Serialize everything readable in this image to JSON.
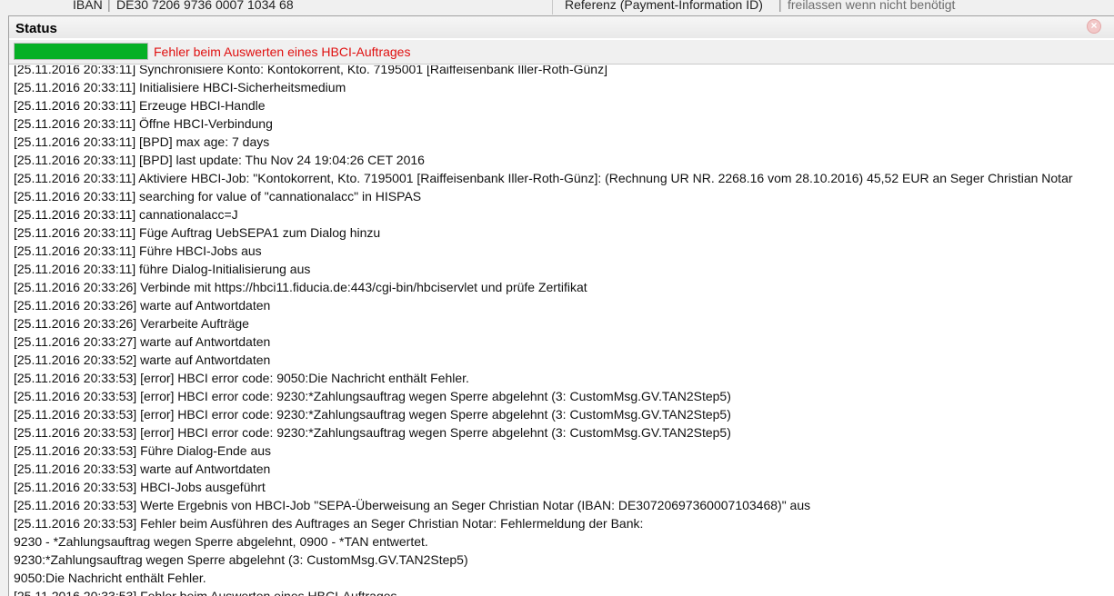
{
  "form_row": {
    "iban_label": "IBAN",
    "iban_value": "DE30 7206 9736 0007 1034 68",
    "reference_label": "Referenz (Payment-Information ID)",
    "reference_hint": "freilassen wenn nicht benötigt"
  },
  "status_panel": {
    "title": "Status",
    "close_icon": "close-icon",
    "progress": {
      "value": 1.0,
      "message": "Fehler beim Auswerten eines HBCI-Auftrages",
      "bar_color": "#06b025",
      "message_color": "#e01010"
    },
    "log": [
      "[25.11.2016 20:33:11] Synchronisiere Konto: Kontokorrent, Kto. 7195001 [Raiffeisenbank Iller-Roth-Günz]",
      "[25.11.2016 20:33:11] Initialisiere HBCI-Sicherheitsmedium",
      "[25.11.2016 20:33:11] Erzeuge HBCI-Handle",
      "[25.11.2016 20:33:11] Öffne HBCI-Verbindung",
      "[25.11.2016 20:33:11] [BPD] max age: 7 days",
      "[25.11.2016 20:33:11] [BPD] last update: Thu Nov 24 19:04:26 CET 2016",
      "[25.11.2016 20:33:11] Aktiviere HBCI-Job: \"Kontokorrent, Kto. 7195001 [Raiffeisenbank Iller-Roth-Günz]: (Rechnung UR NR. 2268.16 vom 28.10.2016) 45,52 EUR an Seger Christian Notar",
      "[25.11.2016 20:33:11] searching for value of \"cannationalacc\" in HISPAS",
      "[25.11.2016 20:33:11] cannationalacc=J",
      "[25.11.2016 20:33:11] Füge Auftrag UebSEPA1 zum Dialog hinzu",
      "[25.11.2016 20:33:11] Führe HBCI-Jobs aus",
      "[25.11.2016 20:33:11] führe Dialog-Initialisierung aus",
      "[25.11.2016 20:33:26] Verbinde mit https://hbci11.fiducia.de:443/cgi-bin/hbciservlet und prüfe Zertifikat",
      "[25.11.2016 20:33:26] warte auf Antwortdaten",
      "[25.11.2016 20:33:26] Verarbeite Aufträge",
      "[25.11.2016 20:33:27] warte auf Antwortdaten",
      "[25.11.2016 20:33:52] warte auf Antwortdaten",
      "[25.11.2016 20:33:53] [error] HBCI error code: 9050:Die Nachricht enthält Fehler.",
      "[25.11.2016 20:33:53] [error] HBCI error code: 9230:*Zahlungsauftrag wegen Sperre abgelehnt (3: CustomMsg.GV.TAN2Step5)",
      "[25.11.2016 20:33:53] [error] HBCI error code: 9230:*Zahlungsauftrag wegen Sperre abgelehnt (3: CustomMsg.GV.TAN2Step5)",
      "[25.11.2016 20:33:53] [error] HBCI error code: 9230:*Zahlungsauftrag wegen Sperre abgelehnt (3: CustomMsg.GV.TAN2Step5)",
      "[25.11.2016 20:33:53] Führe Dialog-Ende aus",
      "[25.11.2016 20:33:53] warte auf Antwortdaten",
      "[25.11.2016 20:33:53] HBCI-Jobs ausgeführt",
      "[25.11.2016 20:33:53] Werte Ergebnis von HBCI-Job \"SEPA-Überweisung an Seger Christian Notar (IBAN: DE30720697360007103468)\" aus",
      "[25.11.2016 20:33:53] Fehler beim Ausführen des Auftrages an Seger Christian Notar: Fehlermeldung der Bank:",
      "9230 - *Zahlungsauftrag wegen Sperre abgelehnt, 0900 - *TAN entwertet.",
      "9230:*Zahlungsauftrag wegen Sperre abgelehnt (3: CustomMsg.GV.TAN2Step5)",
      "9050:Die Nachricht enthält Fehler.",
      "[25.11.2016 20:33:53] Fehler beim Auswerten eines HBCI-Auftrages"
    ]
  }
}
